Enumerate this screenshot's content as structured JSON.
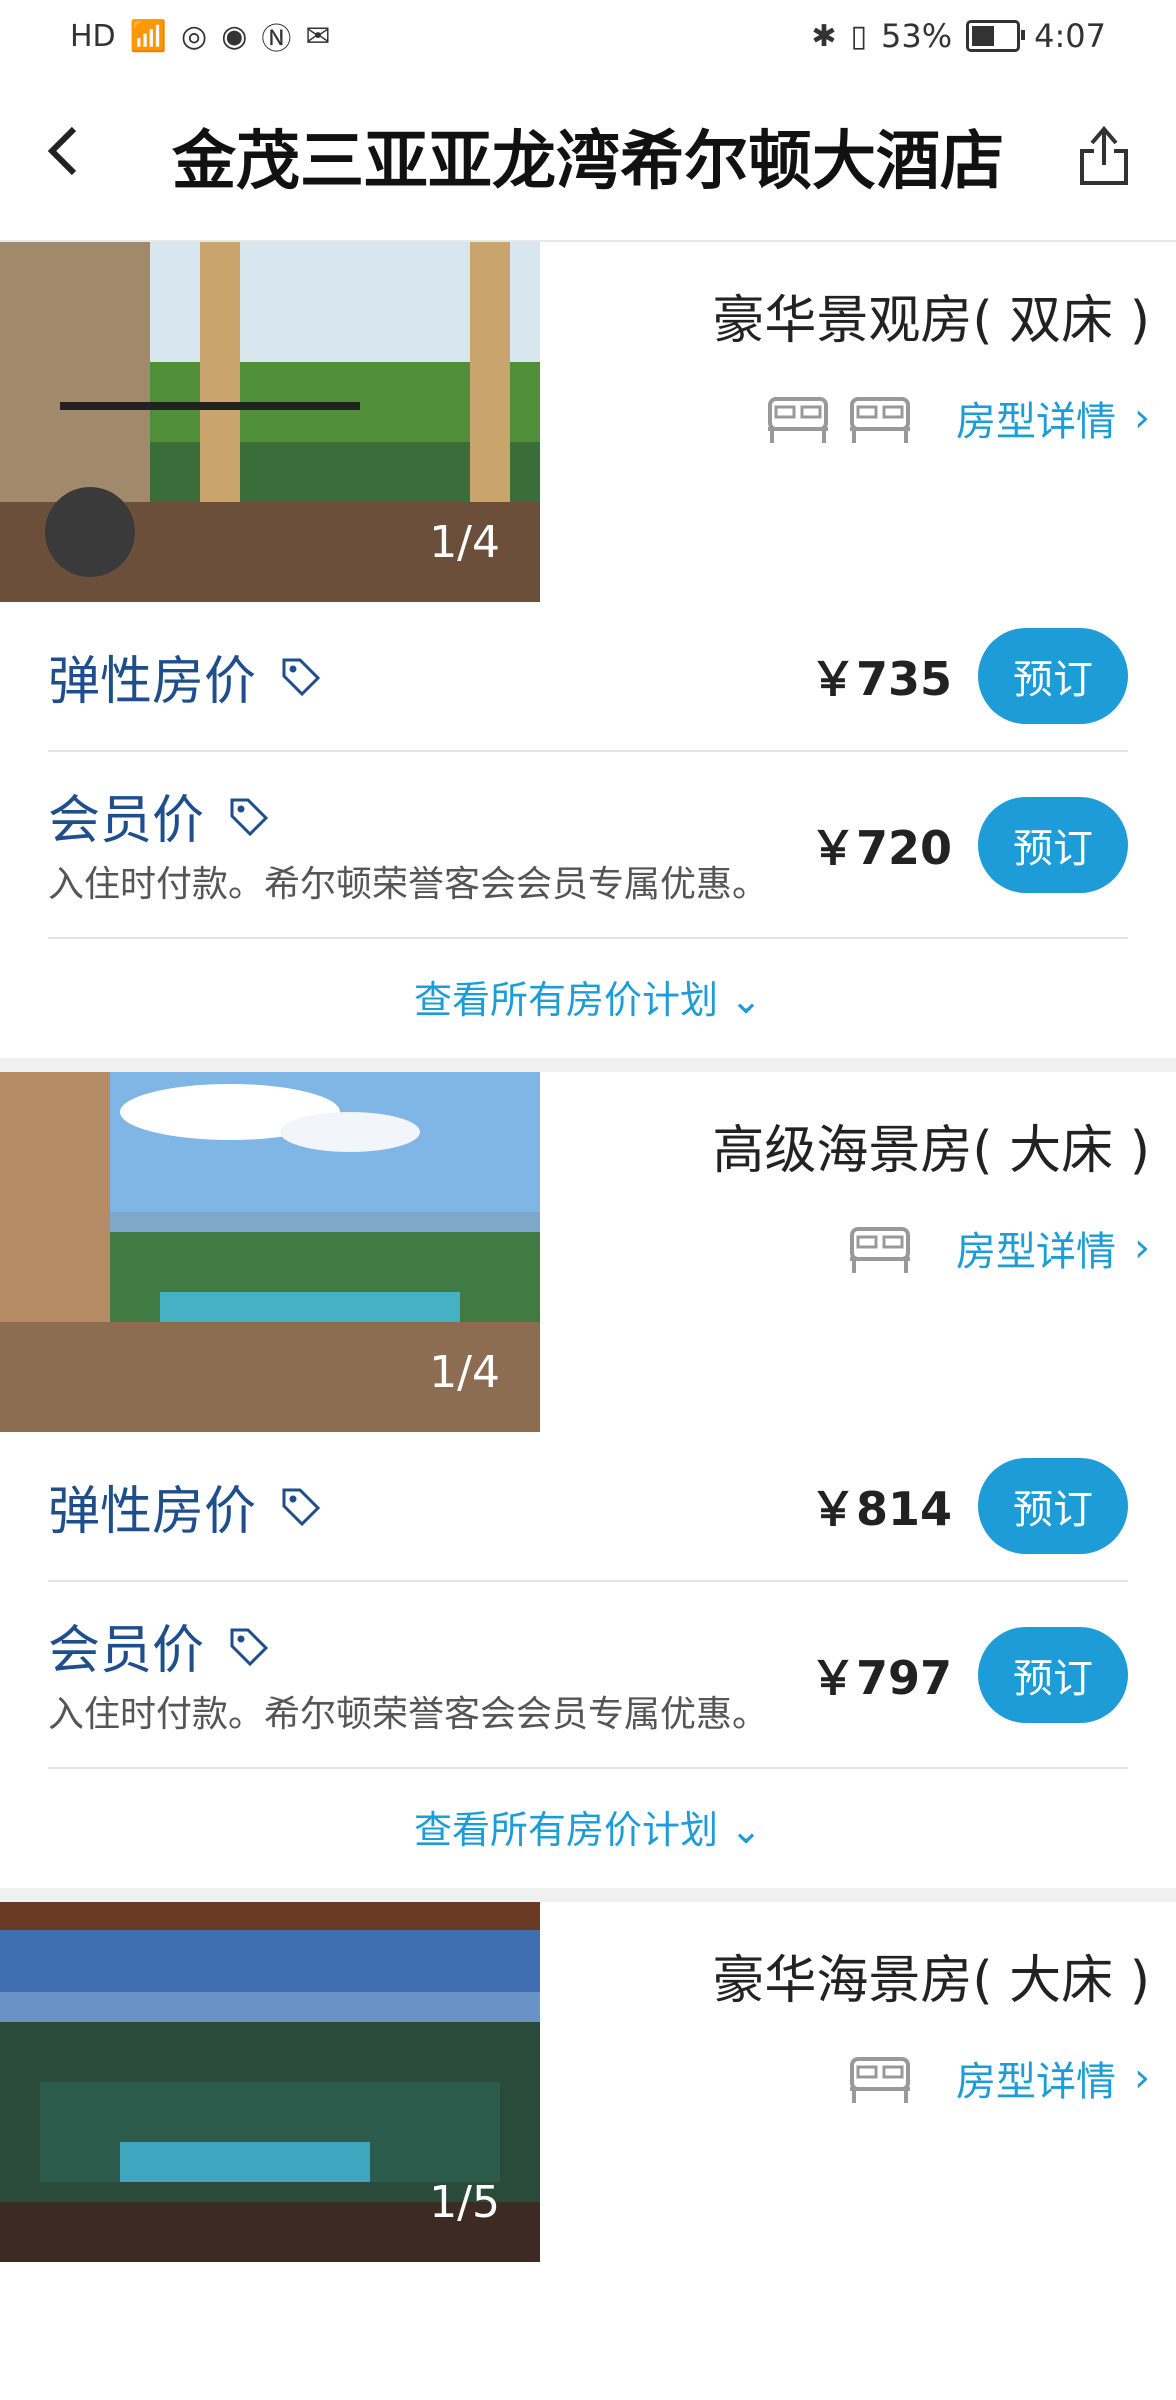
{
  "status_bar": {
    "left_icons": [
      "HD",
      "4G",
      "signal-icon",
      "hotspot-icon",
      "eye-icon",
      "nfc-icon",
      "mail-icon"
    ],
    "battery_pct": "53%",
    "time": "4:07"
  },
  "header": {
    "title": "金茂三亚亚龙湾希尔顿大酒店",
    "back_icon": "chevron-left-icon",
    "share_icon": "share-icon"
  },
  "rooms": [
    {
      "name": "豪华景观房( 双床 )",
      "photo_counter": "1/4",
      "beds": 2,
      "details_label": "房型详情",
      "rates": [
        {
          "title": "弹性房价",
          "desc": "",
          "price": "￥735",
          "book": "预订"
        },
        {
          "title": "会员价",
          "desc": "入住时付款。希尔顿荣誉客会会员专属优惠。",
          "price": "￥720",
          "book": "预订"
        }
      ],
      "view_all": "查看所有房价计划"
    },
    {
      "name": "高级海景房( 大床 )",
      "photo_counter": "1/4",
      "beds": 1,
      "details_label": "房型详情",
      "rates": [
        {
          "title": "弹性房价",
          "desc": "",
          "price": "￥814",
          "book": "预订"
        },
        {
          "title": "会员价",
          "desc": "入住时付款。希尔顿荣誉客会会员专属优惠。",
          "price": "￥797",
          "book": "预订"
        }
      ],
      "view_all": "查看所有房价计划"
    },
    {
      "name": "豪华海景房( 大床 )",
      "photo_counter": "1/5",
      "beds": 1,
      "details_label": "房型详情"
    }
  ],
  "colors": {
    "accent": "#1e9cd7",
    "rate_title": "#1f4e8c"
  }
}
